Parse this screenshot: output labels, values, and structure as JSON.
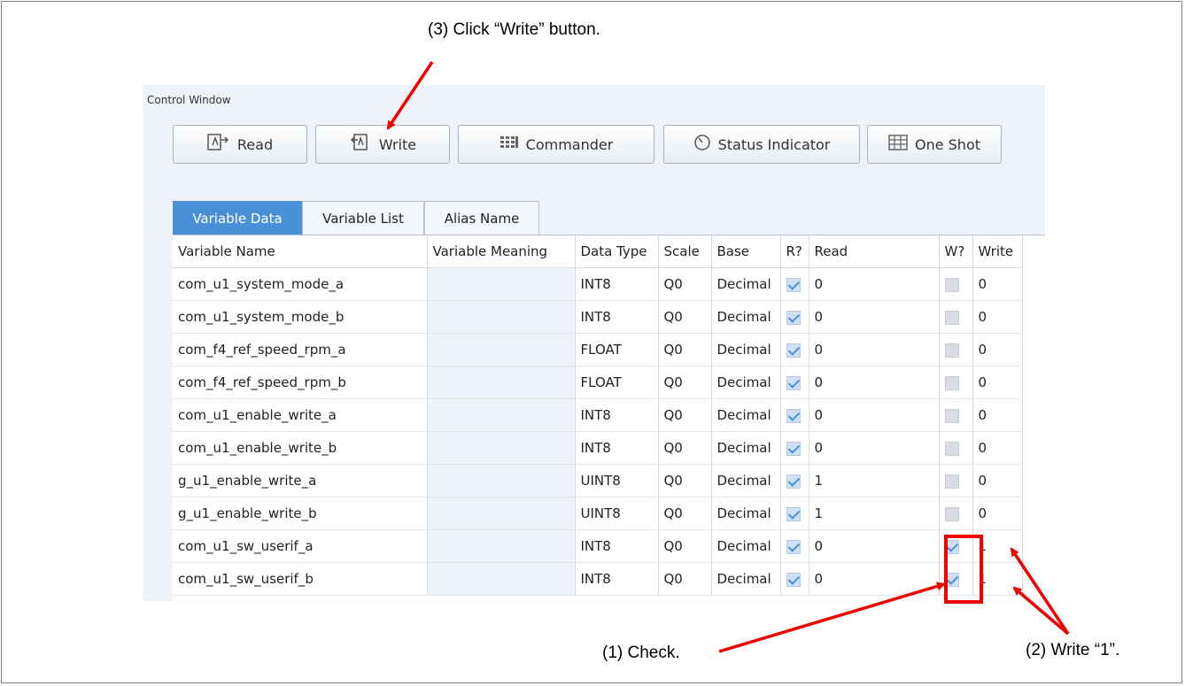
{
  "annotations": {
    "step3": "(3)  Click “Write” button.",
    "step1": "(1)  Check.",
    "step2": "(2)  Write “1”."
  },
  "window": {
    "title": "Control Window",
    "toolbar": {
      "read": "Read",
      "write": "Write",
      "commander": "Commander",
      "status_indicator": "Status Indicator",
      "one_shot": "One Shot"
    },
    "tabs": [
      "Variable Data",
      "Variable List",
      "Alias Name"
    ],
    "active_tab": "Variable Data"
  },
  "table": {
    "columns": [
      "Variable Name",
      "Variable Meaning",
      "Data Type",
      "Scale",
      "Base",
      "R?",
      "Read",
      "W?",
      "Write"
    ],
    "rows": [
      {
        "name": "com_u1_system_mode_a",
        "meaning": "",
        "type": "INT8",
        "scale": "Q0",
        "base": "Decimal",
        "r": true,
        "read": "0",
        "w": false,
        "write": "0"
      },
      {
        "name": "com_u1_system_mode_b",
        "meaning": "",
        "type": "INT8",
        "scale": "Q0",
        "base": "Decimal",
        "r": true,
        "read": "0",
        "w": false,
        "write": "0"
      },
      {
        "name": "com_f4_ref_speed_rpm_a",
        "meaning": "",
        "type": "FLOAT",
        "scale": "Q0",
        "base": "Decimal",
        "r": true,
        "read": "0",
        "w": false,
        "write": "0"
      },
      {
        "name": "com_f4_ref_speed_rpm_b",
        "meaning": "",
        "type": "FLOAT",
        "scale": "Q0",
        "base": "Decimal",
        "r": true,
        "read": "0",
        "w": false,
        "write": "0"
      },
      {
        "name": "com_u1_enable_write_a",
        "meaning": "",
        "type": "INT8",
        "scale": "Q0",
        "base": "Decimal",
        "r": true,
        "read": "0",
        "w": false,
        "write": "0"
      },
      {
        "name": "com_u1_enable_write_b",
        "meaning": "",
        "type": "INT8",
        "scale": "Q0",
        "base": "Decimal",
        "r": true,
        "read": "0",
        "w": false,
        "write": "0"
      },
      {
        "name": "g_u1_enable_write_a",
        "meaning": "",
        "type": "UINT8",
        "scale": "Q0",
        "base": "Decimal",
        "r": true,
        "read": "1",
        "w": false,
        "write": "0"
      },
      {
        "name": "g_u1_enable_write_b",
        "meaning": "",
        "type": "UINT8",
        "scale": "Q0",
        "base": "Decimal",
        "r": true,
        "read": "1",
        "w": false,
        "write": "0"
      },
      {
        "name": "com_u1_sw_userif_a",
        "meaning": "",
        "type": "INT8",
        "scale": "Q0",
        "base": "Decimal",
        "r": true,
        "read": "0",
        "w": true,
        "write": "1"
      },
      {
        "name": "com_u1_sw_userif_b",
        "meaning": "",
        "type": "INT8",
        "scale": "Q0",
        "base": "Decimal",
        "r": true,
        "read": "0",
        "w": true,
        "write": "1"
      }
    ]
  },
  "colors": {
    "accent": "#4a90d9",
    "annotation_red": "#e00000",
    "window_bg": "#eef3fa"
  }
}
